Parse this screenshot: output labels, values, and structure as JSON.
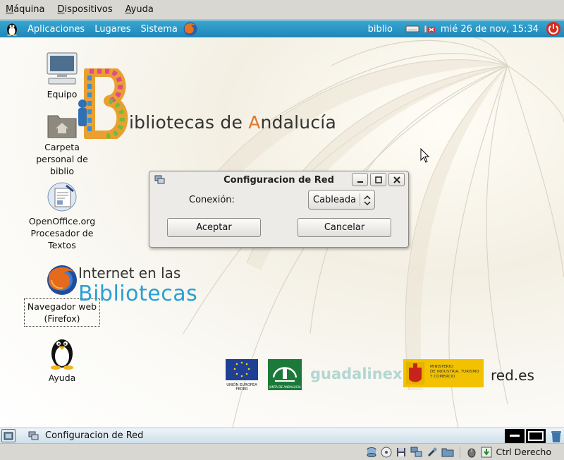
{
  "host_menu": [
    {
      "label": "Máquina",
      "key": "M"
    },
    {
      "label": "Dispositivos",
      "key": "D"
    },
    {
      "label": "Ayuda",
      "key": "A"
    }
  ],
  "top_panel": {
    "menus": [
      "Aplicaciones",
      "Lugares",
      "Sistema"
    ],
    "user": "biblio",
    "clock": "mié 26 de nov, 15:34"
  },
  "desktop_icons": [
    {
      "label": "Equipo",
      "icon": "computer-icon"
    },
    {
      "label": "Carpeta personal de biblio",
      "icon": "home-folder-icon"
    },
    {
      "label": "OpenOffice.org Procesador de Textos",
      "icon": "writer-icon"
    },
    {
      "label": "Navegador web (Firefox)",
      "icon": "firefox-icon"
    },
    {
      "label": "Ayuda",
      "icon": "tux-icon"
    }
  ],
  "branding": {
    "biblio_word_first": "B",
    "biblio_word_rest": "ibliotecas de ",
    "biblio_word_a": "A",
    "biblio_word_end": "ndalucía",
    "internet_line1": "Internet en las",
    "internet_line2": "Bibliotecas",
    "sponsors": {
      "ue_line1": "UNIÓN EUROPEA",
      "ue_line2": "FEDER",
      "junta": "JUNTA DE ANDALUCIA",
      "guadalinex": "guadalinex v5",
      "ministerio_line1": "MINISTERIO",
      "ministerio_line2": "DE INDUSTRIA, TURISMO",
      "ministerio_line3": "Y COMERCIO",
      "redes": "red.es"
    }
  },
  "dialog": {
    "title": "Configuracion de Red",
    "connection_label": "Conexión:",
    "connection_value": "Cableada",
    "accept_label": "Aceptar",
    "cancel_label": "Cancelar"
  },
  "bottom_panel": {
    "task_label": "Configuracion de Red"
  },
  "host_status": {
    "host_key": "Ctrl Derecho"
  },
  "colors": {
    "panel_blue": "#1f86b8",
    "biblio_orange": "#e0762a",
    "internet_blue": "#2a9fd3"
  }
}
